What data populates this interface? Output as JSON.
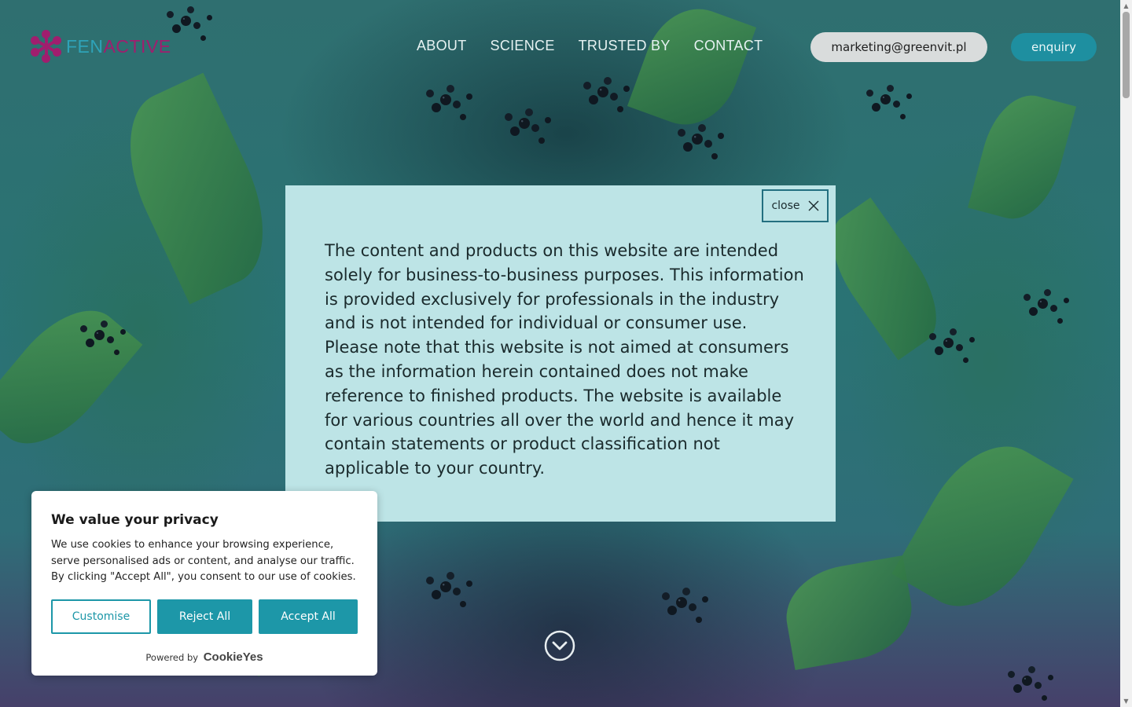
{
  "header": {
    "logo": {
      "part1": "FEN",
      "part2": "ACTIVE"
    },
    "nav": [
      {
        "label": "ABOUT"
      },
      {
        "label": "SCIENCE"
      },
      {
        "label": "TRUSTED BY"
      },
      {
        "label": "CONTACT"
      }
    ],
    "email_label": "marketing@greenvit.pl",
    "enquiry_label": "enquiry"
  },
  "modal": {
    "close_label": "close",
    "close_icon": "close-icon",
    "text": "The content and products on this website are intended solely for business-to-business purposes. This information is provided exclusively for professionals in the industry and is not intended for individual or consumer use. Please note that this website is not aimed at consumers as the information herein contained does not make reference to finished products. The website is available for various countries all over the world and hence it may contain statements or product classification not applicable to your country."
  },
  "scroll_down_icon": "chevron-down-circle-icon",
  "cookie": {
    "title": "We value your privacy",
    "body": "We use cookies to enhance your browsing experience, serve personalised ads or content, and analyse our traffic. By clicking \"Accept All\", you consent to our use of cookies.",
    "customise_label": "Customise",
    "reject_label": "Reject All",
    "accept_label": "Accept All",
    "powered_by": "Powered by",
    "brand": "CookieYes"
  },
  "colors": {
    "accent": "#1d97a8",
    "modal_bg": "#bde4e6",
    "logo_magenta": "#a01e6e",
    "logo_teal": "#2ea3b8"
  }
}
